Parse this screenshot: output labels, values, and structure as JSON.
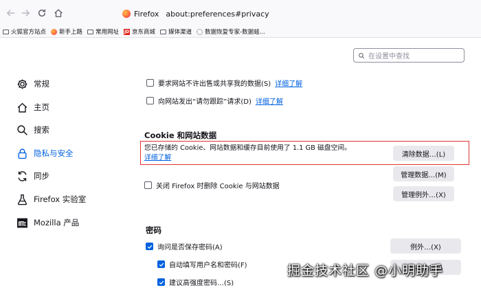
{
  "toolbar": {
    "identity_label": "Firefox",
    "url": "about:preferences#privacy"
  },
  "bookmarks": [
    {
      "label": "火狐官方站点",
      "icon": "folder-icon"
    },
    {
      "label": "新手上路",
      "icon": "firefox-icon"
    },
    {
      "label": "常用网址",
      "icon": "folder-icon"
    },
    {
      "label": "京东商城",
      "icon": "jd-icon"
    },
    {
      "label": "媒体渠道",
      "icon": "folder-icon"
    },
    {
      "label": "数据恢复专家-数据蛙...",
      "icon": "site-icon"
    }
  ],
  "search": {
    "placeholder": "在设置中查找"
  },
  "sidebar": {
    "items": [
      {
        "label": "常规",
        "icon": "gear-icon"
      },
      {
        "label": "主页",
        "icon": "home-icon"
      },
      {
        "label": "搜索",
        "icon": "search-icon"
      },
      {
        "label": "隐私与安全",
        "icon": "lock-icon",
        "selected": true
      },
      {
        "label": "同步",
        "icon": "sync-icon"
      },
      {
        "label": "Firefox 实验室",
        "icon": "flask-icon"
      },
      {
        "label": "Mozilla 产品",
        "icon": "mozilla-icon"
      }
    ]
  },
  "tracking": {
    "do_not_sell": {
      "label": "要求网站不许出售或共享我的数据(S)",
      "link": "详细了解",
      "checked": false
    },
    "do_not_track": {
      "label": "向网站发出“请勿跟踪”请求(D)",
      "link": "详细了解",
      "checked": false
    }
  },
  "cookies": {
    "title": "Cookie 和网站数据",
    "description": "您已存储的 Cookie、网站数据和缓存目前使用了 1.1 GB 磁盘空间。",
    "learn_more": "详细了解",
    "delete_on_close": {
      "label": "关闭 Firefox 时删除 Cookie 与网站数据",
      "checked": false
    },
    "clear_button": "清除数据…(L)",
    "manage_button": "管理数据…(M)",
    "exceptions_button": "管理例外…(X)"
  },
  "passwords": {
    "title": "密码",
    "ask_to_save": {
      "label": "询问是否保存密码(A)",
      "checked": true
    },
    "autofill": {
      "label": "自动填写用户名和密码(F)",
      "checked": true
    },
    "suggest_strong": {
      "label": "建议高强度密码…(S)",
      "checked": true
    },
    "exceptions_button": "例外…(X)",
    "saved_logins_button": "保存的密码"
  },
  "watermark": "掘金技术社区 @小明助手",
  "colors": {
    "accent": "#0061e0",
    "highlight_border": "#e03232",
    "button_bg": "#e9e9ed"
  }
}
